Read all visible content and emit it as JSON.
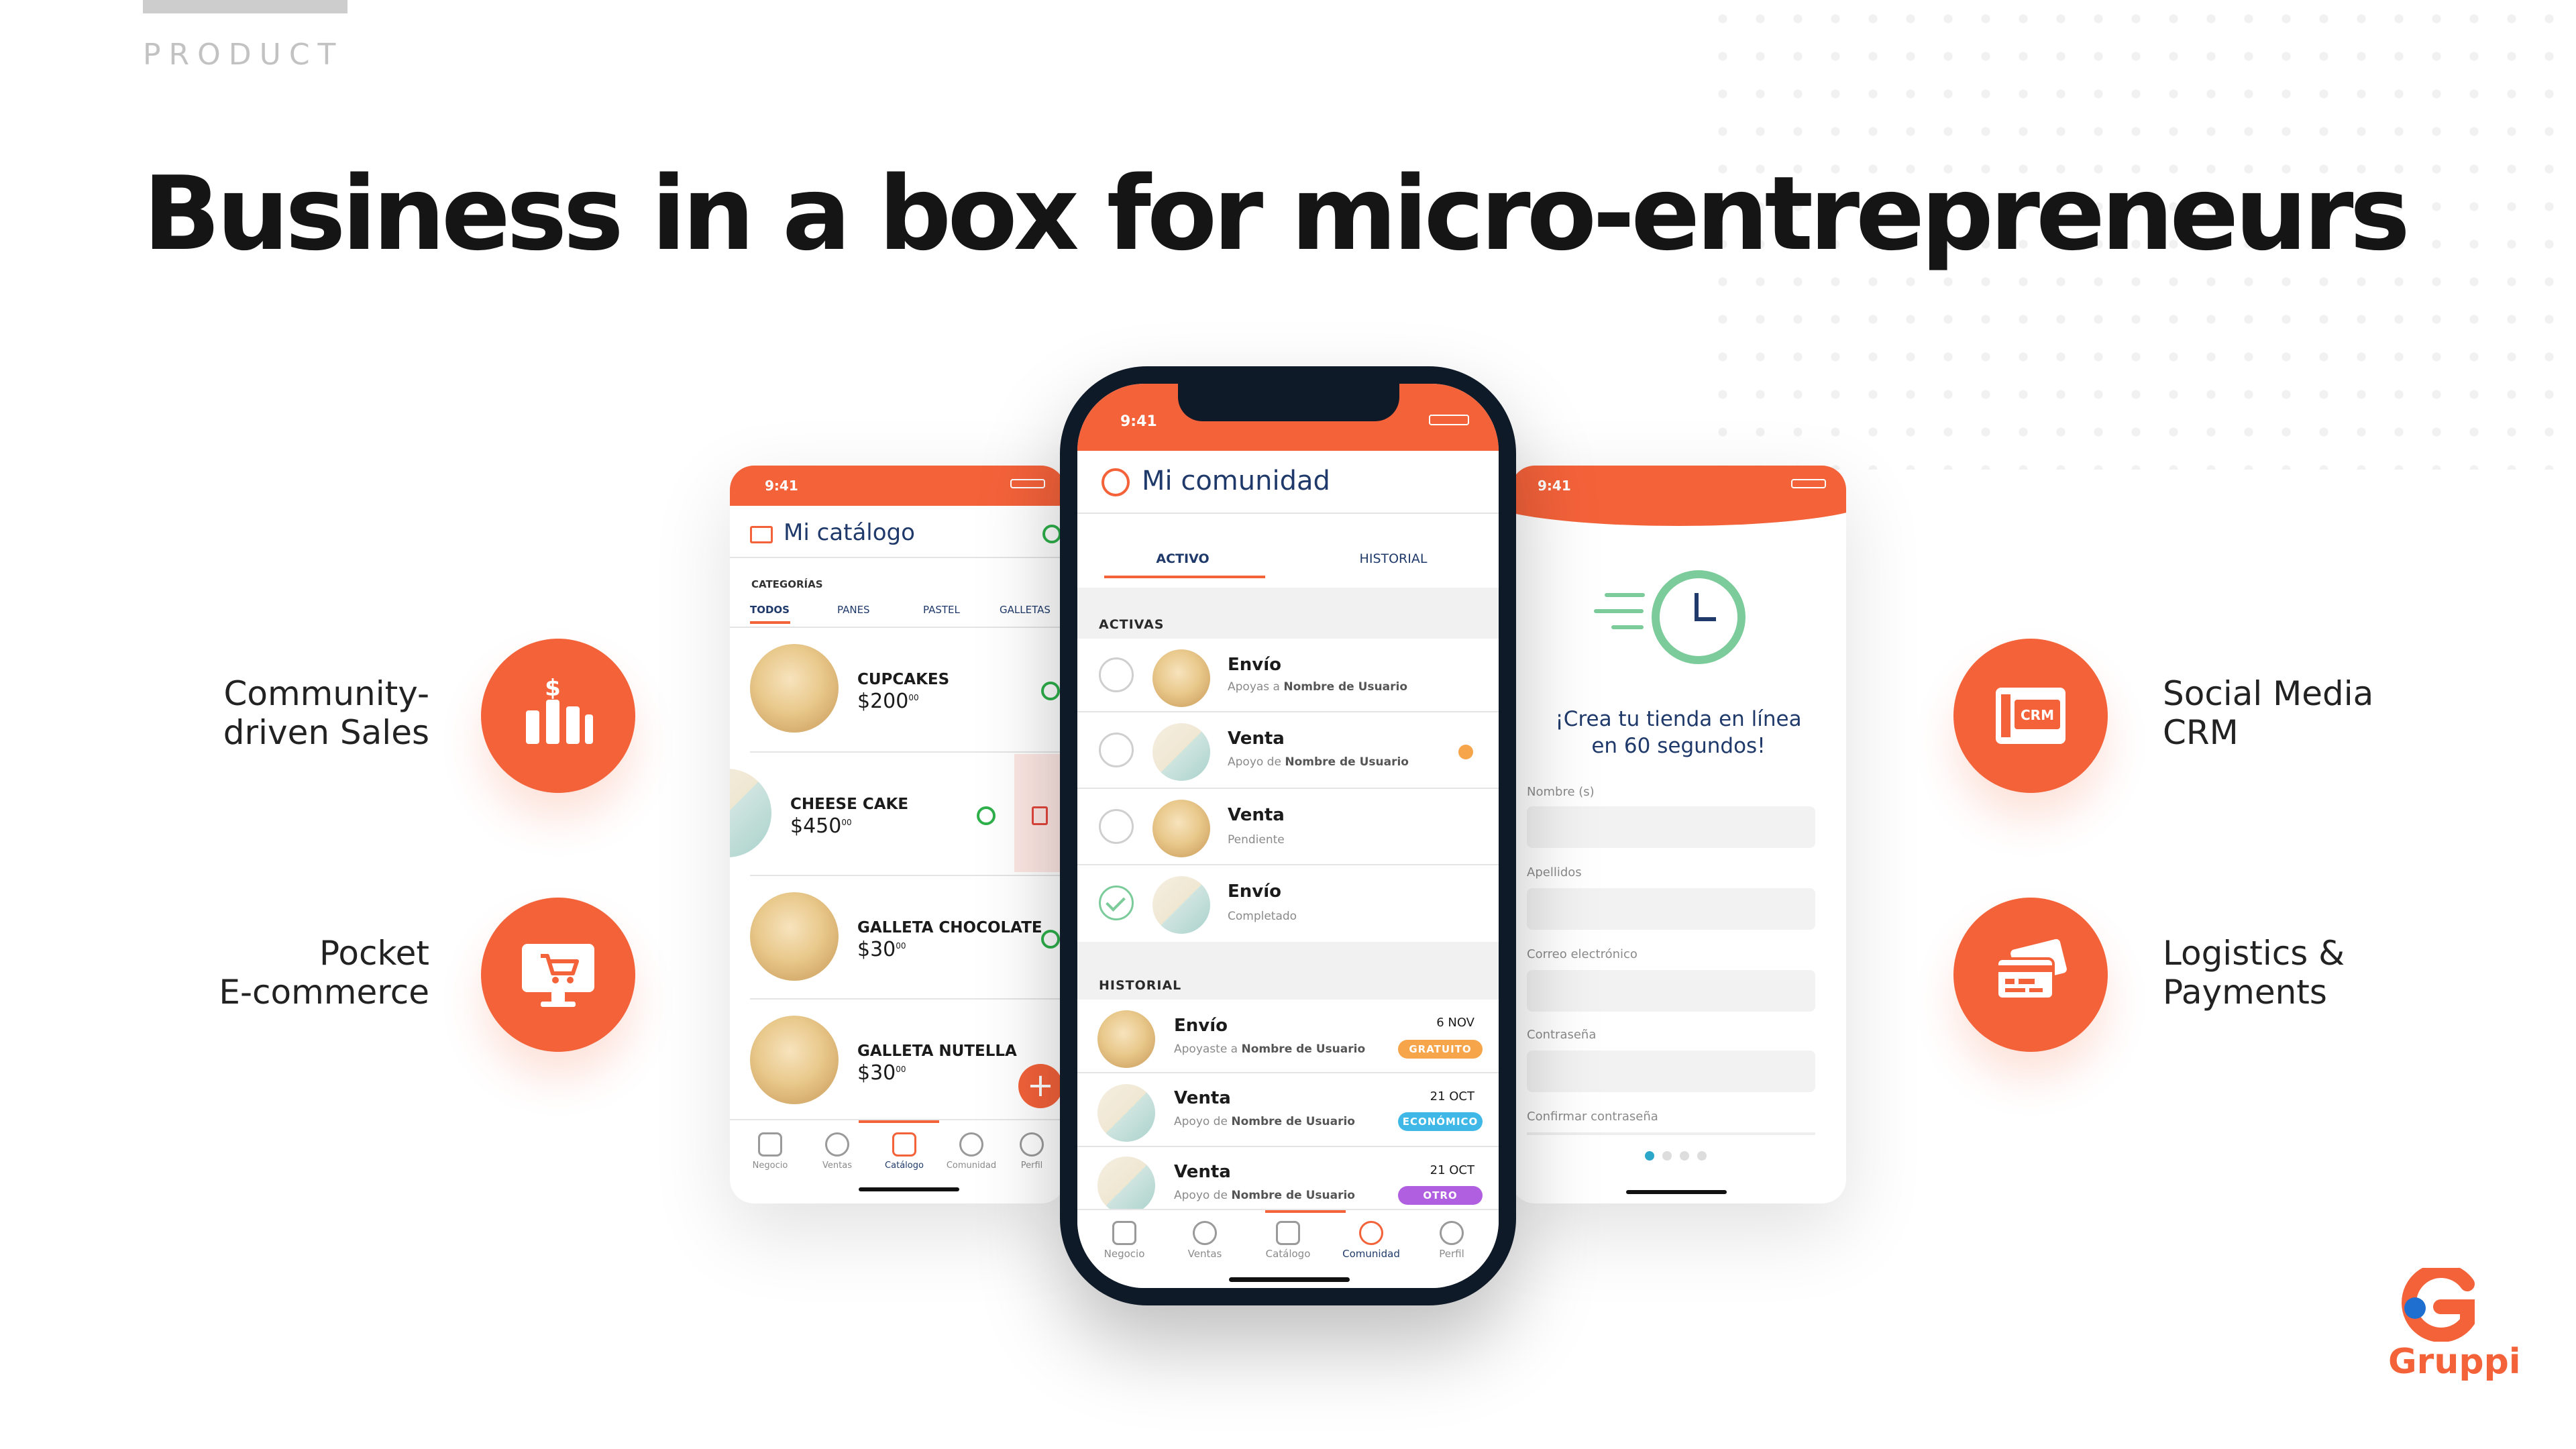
{
  "kicker": "PRODUCT",
  "headline": "Business in a box for micro-entrepreneurs",
  "colors": {
    "accent": "#f4623a",
    "navy": "#1f3a6a",
    "green": "#2eb04b"
  },
  "features": {
    "community_sales": {
      "line1": "Community-",
      "line2": "driven Sales",
      "icon": "bar-chart-dollar-icon"
    },
    "pocket_ecommerce": {
      "line1": "Pocket",
      "line2": "E-commerce",
      "icon": "monitor-cart-icon"
    },
    "social_crm": {
      "line1": "Social Media",
      "line2": "CRM",
      "icon": "crm-browser-icon",
      "icon_text": "CRM"
    },
    "logistics_payments": {
      "line1": "Logistics &",
      "line2": "Payments",
      "icon": "cards-icon"
    }
  },
  "catalog_screen": {
    "time": "9:41",
    "title": "Mi catálogo",
    "categories_label": "CATEGORÍAS",
    "tabs": [
      "TODOS",
      "PANES",
      "PASTEL",
      "GALLETAS"
    ],
    "products": [
      {
        "name": "CUPCAKES",
        "price": "$200",
        "cents": "00"
      },
      {
        "name": "CHEESE CAKE",
        "price": "$450",
        "cents": "00"
      },
      {
        "name": "GALLETA CHOCOLATE",
        "price": "$30",
        "cents": "00"
      },
      {
        "name": "GALLETA NUTELLA",
        "price": "$30",
        "cents": "00"
      }
    ],
    "fab": "+",
    "nav": [
      "Negocio",
      "Ventas",
      "Catálogo",
      "Comunidad",
      "Perfil"
    ]
  },
  "community_screen": {
    "time": "9:41",
    "title": "Mi comunidad",
    "tabs": [
      "ACTIVO",
      "HISTORIAL"
    ],
    "active_header": "ACTIVAS",
    "active_items": [
      {
        "title": "Envío",
        "sub_pre": "Apoyas a ",
        "sub_bold": "Nombre de Usuario",
        "checked": false
      },
      {
        "title": "Venta",
        "sub_pre": "Apoyo de ",
        "sub_bold": "Nombre de Usuario",
        "checked": false
      },
      {
        "title": "Venta",
        "sub_pre": "Pendiente",
        "sub_bold": "",
        "checked": false
      },
      {
        "title": "Envío",
        "sub_pre": "Completado",
        "sub_bold": "",
        "checked": true
      }
    ],
    "history_header": "HISTORIAL",
    "history_items": [
      {
        "title": "Envío",
        "sub_pre": "Apoyaste a ",
        "sub_bold": "Nombre de Usuario",
        "date": "6 NOV",
        "badge": "GRATUITO",
        "badge_color": "#f7a54a"
      },
      {
        "title": "Venta",
        "sub_pre": "Apoyo de ",
        "sub_bold": "Nombre de Usuario",
        "date": "21 OCT",
        "badge": "ECONÓMICO",
        "badge_color": "#3fb8e8"
      },
      {
        "title": "Venta",
        "sub_pre": "Apoyo de ",
        "sub_bold": "Nombre de Usuario",
        "date": "21 OCT",
        "badge": "OTRO",
        "badge_color": "#b05fe0"
      }
    ],
    "nav": [
      "Negocio",
      "Ventas",
      "Catálogo",
      "Comunidad",
      "Perfil"
    ]
  },
  "signup_screen": {
    "time": "9:41",
    "headline_line1": "¡Crea tu tienda en línea",
    "headline_line2": "en 60 segundos!",
    "fields": [
      "Nombre (s)",
      "Apellidos",
      "Correo electrónico",
      "Contraseña",
      "Confirmar contraseña"
    ]
  },
  "brand": {
    "name": "Gruppi"
  }
}
